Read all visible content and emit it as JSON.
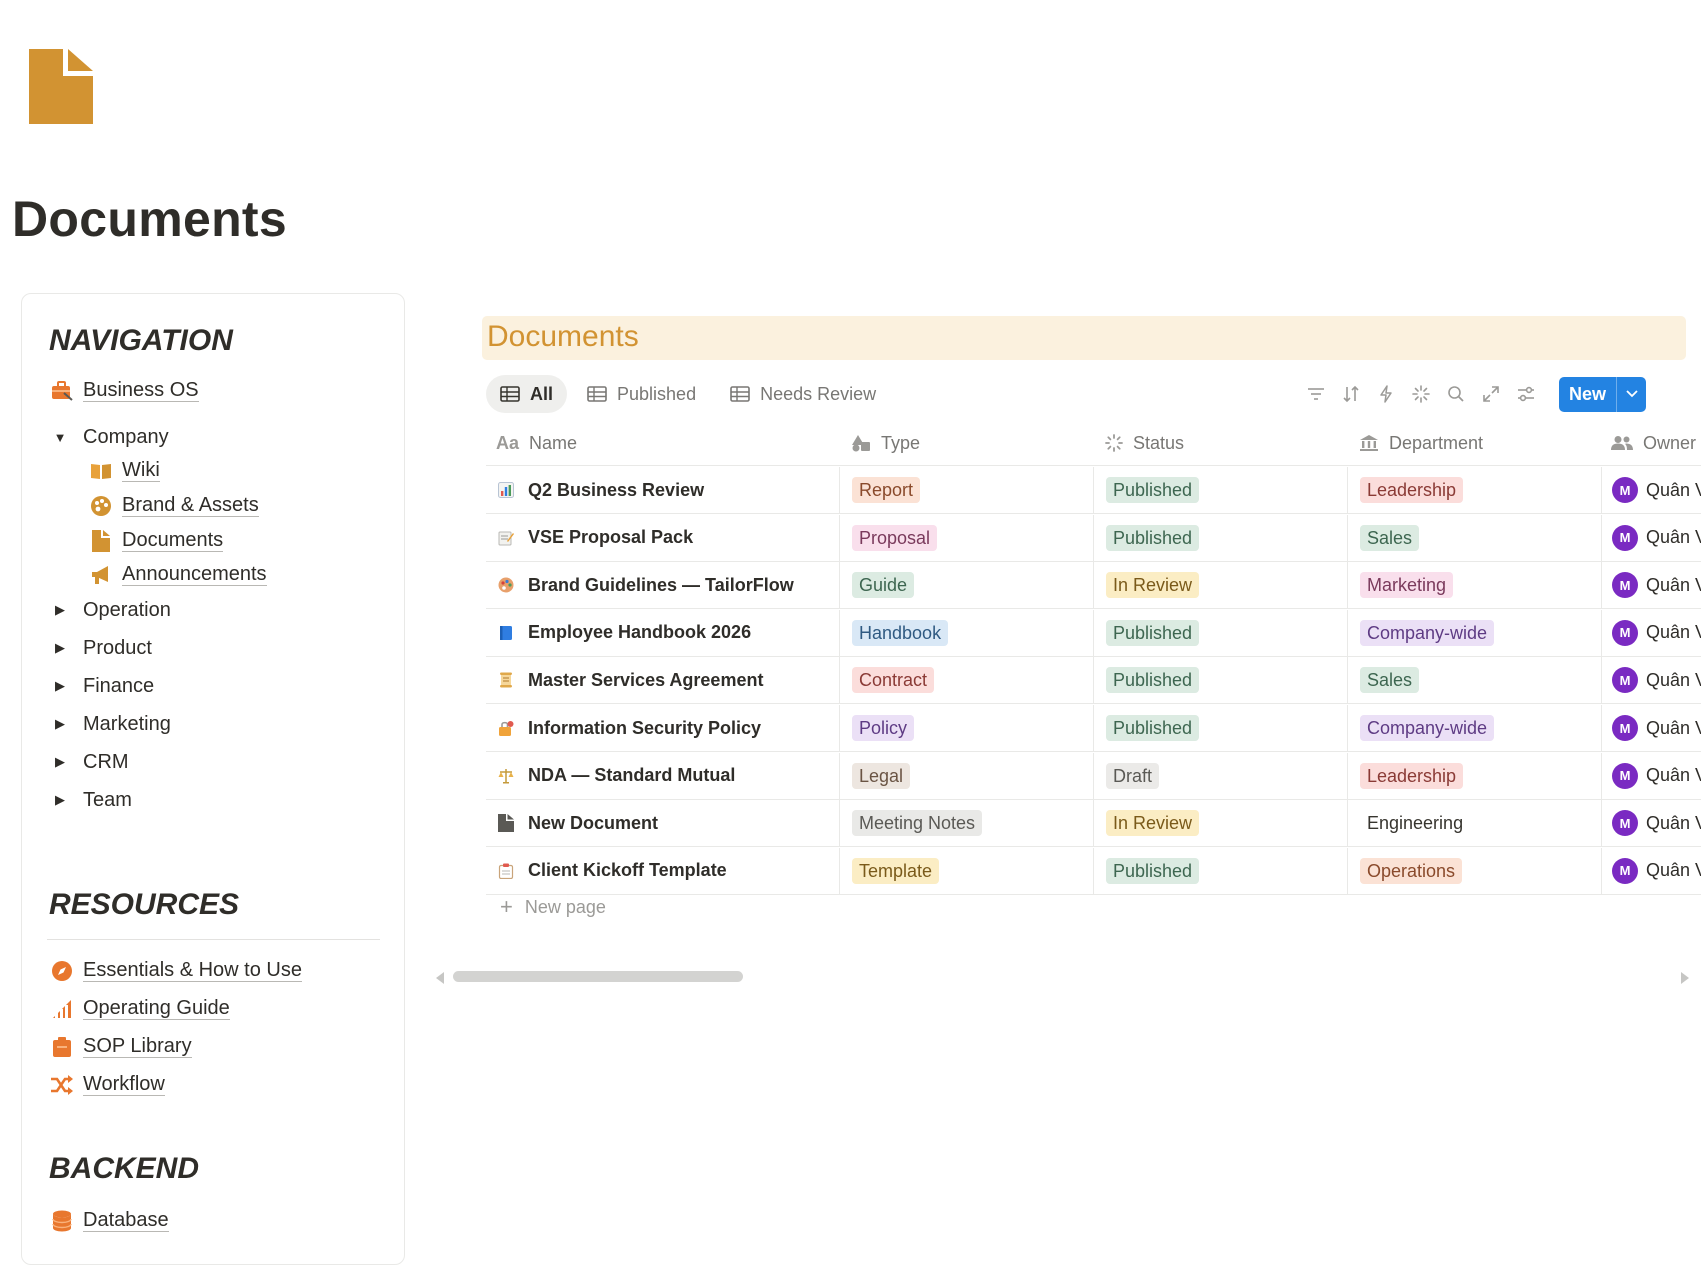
{
  "page": {
    "title": "Documents",
    "icon": "document-icon",
    "icon_color": "#d29332"
  },
  "sidebar": {
    "navigation": {
      "heading": "NAVIGATION",
      "top_link": {
        "label": "Business OS",
        "icon": "briefcase-icon"
      },
      "company": {
        "label": "Company",
        "children": [
          {
            "label": "Wiki",
            "icon": "book-icon"
          },
          {
            "label": "Brand & Assets",
            "icon": "palette-icon"
          },
          {
            "label": "Documents",
            "icon": "document-icon"
          },
          {
            "label": "Announcements",
            "icon": "megaphone-icon"
          }
        ]
      },
      "collapsed": [
        "Operation",
        "Product",
        "Finance",
        "Marketing",
        "CRM",
        "Team"
      ]
    },
    "resources": {
      "heading": "RESOURCES",
      "items": [
        {
          "label": "Essentials & How to Use",
          "icon": "compass-icon"
        },
        {
          "label": "Operating Guide",
          "icon": "chart-icon"
        },
        {
          "label": "SOP Library",
          "icon": "clipboard-icon"
        },
        {
          "label": "Workflow",
          "icon": "shuffle-icon"
        }
      ]
    },
    "backend": {
      "heading": "BACKEND",
      "items": [
        {
          "label": "Database",
          "icon": "database-icon"
        }
      ]
    }
  },
  "database": {
    "title": "Documents",
    "views": [
      {
        "label": "All",
        "active": true
      },
      {
        "label": "Published",
        "active": false
      },
      {
        "label": "Needs Review",
        "active": false
      }
    ],
    "new_button": "New",
    "columns": {
      "name": "Name",
      "type": "Type",
      "status": "Status",
      "department": "Department",
      "owner": "Owner"
    },
    "rows": [
      {
        "name": "Q2 Business Review",
        "icon": "bar-chart-icon",
        "type": "Report",
        "status": "Published",
        "department": "Leadership",
        "owner_initial": "M",
        "owner": "Quân V"
      },
      {
        "name": "VSE Proposal Pack",
        "icon": "memo-icon",
        "type": "Proposal",
        "status": "Published",
        "department": "Sales",
        "owner_initial": "M",
        "owner": "Quân V"
      },
      {
        "name": "Brand Guidelines — TailorFlow",
        "icon": "palette-icon",
        "type": "Guide",
        "status": "In Review",
        "department": "Marketing",
        "owner_initial": "M",
        "owner": "Quân V"
      },
      {
        "name": "Employee Handbook 2026",
        "icon": "blue-book-icon",
        "type": "Handbook",
        "status": "Published",
        "department": "Company-wide",
        "owner_initial": "M",
        "owner": "Quân V"
      },
      {
        "name": "Master Services Agreement",
        "icon": "scroll-icon",
        "type": "Contract",
        "status": "Published",
        "department": "Sales",
        "owner_initial": "M",
        "owner": "Quân V"
      },
      {
        "name": "Information Security Policy",
        "icon": "lock-icon",
        "type": "Policy",
        "status": "Published",
        "department": "Company-wide",
        "owner_initial": "M",
        "owner": "Quân V"
      },
      {
        "name": "NDA — Standard Mutual",
        "icon": "scales-icon",
        "type": "Legal",
        "status": "Draft",
        "department": "Leadership",
        "owner_initial": "M",
        "owner": "Quân V"
      },
      {
        "name": "New Document",
        "icon": "page-icon",
        "type": "Meeting Notes",
        "status": "In Review",
        "department": "Engineering",
        "owner_initial": "M",
        "owner": "Quân V"
      },
      {
        "name": "Client Kickoff Template",
        "icon": "clipboard-icon",
        "type": "Template",
        "status": "Published",
        "department": "Operations",
        "owner_initial": "M",
        "owner": "Quân V"
      }
    ],
    "new_page_label": "New page",
    "tag_colors": {
      "Report": {
        "bg": "#fbe2d5",
        "fg": "#8a4a2b"
      },
      "Proposal": {
        "bg": "#f9dfec",
        "fg": "#7a3a5c"
      },
      "Guide": {
        "bg": "#dcebe2",
        "fg": "#3d6650"
      },
      "Handbook": {
        "bg": "#d9e8f6",
        "fg": "#2f5a82"
      },
      "Contract": {
        "bg": "#fbdddb",
        "fg": "#8a3a35"
      },
      "Policy": {
        "bg": "#ebe0f6",
        "fg": "#5e3b84"
      },
      "Legal": {
        "bg": "#ede6e0",
        "fg": "#6a5444"
      },
      "Meeting Notes": {
        "bg": "#e9e9e7",
        "fg": "#5a5955"
      },
      "Template": {
        "bg": "#fbedc4",
        "fg": "#7a5a1a"
      },
      "Published": {
        "bg": "#dcebe2",
        "fg": "#3d6650"
      },
      "In Review": {
        "bg": "#fbedc4",
        "fg": "#7a5a1a"
      },
      "Draft": {
        "bg": "#ebeae8",
        "fg": "#5a5955"
      },
      "Leadership": {
        "bg": "#fbdddb",
        "fg": "#8a3a35"
      },
      "Sales": {
        "bg": "#dcebe2",
        "fg": "#3d6650"
      },
      "Marketing": {
        "bg": "#f9dfec",
        "fg": "#7a3a5c"
      },
      "Company-wide": {
        "bg": "#ebe0f6",
        "fg": "#5e3b84"
      },
      "Engineering": {
        "bg": "transparent",
        "fg": "#37352f"
      },
      "Operations": {
        "bg": "#fbe2d5",
        "fg": "#8a4a2b"
      }
    },
    "avatar_color": "#7a2ac2",
    "accent_color": "#2383e2"
  }
}
